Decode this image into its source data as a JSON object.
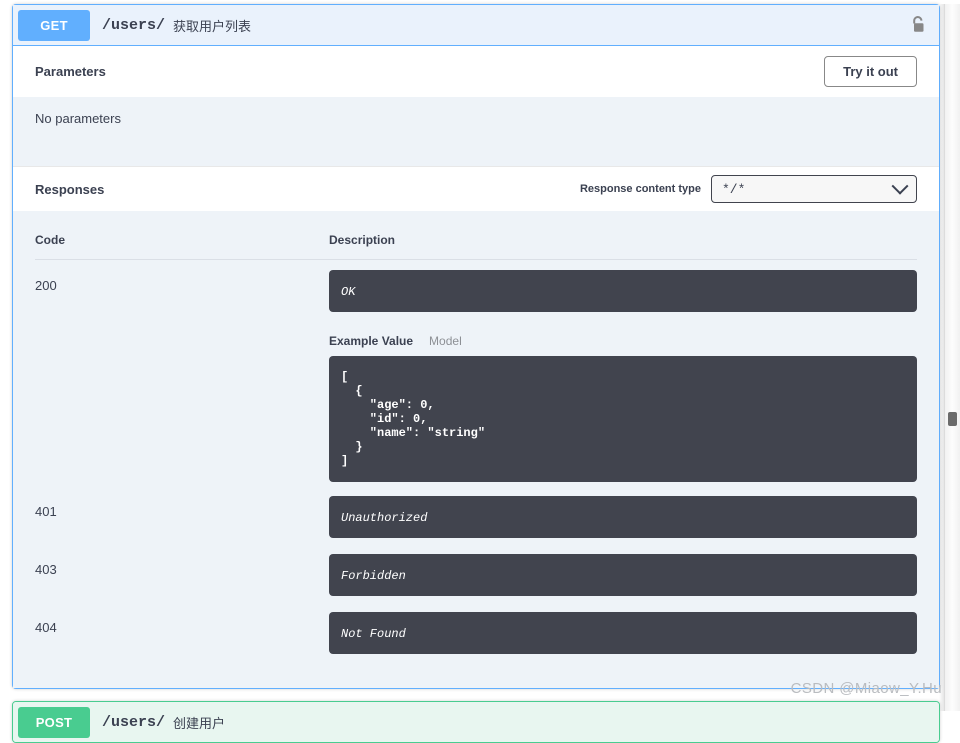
{
  "operation_get": {
    "method": "GET",
    "path": "/users/",
    "summary": "获取用户列表",
    "auth_icon": "unlock-icon",
    "parameters": {
      "title": "Parameters",
      "try_it_out_label": "Try it out",
      "empty_text": "No parameters"
    },
    "responses": {
      "title": "Responses",
      "content_type_label": "Response content type",
      "content_type_value": "*/*",
      "chevron_icon": "chevron-down-icon",
      "columns": {
        "code": "Code",
        "description": "Description"
      },
      "rows": [
        {
          "code": "200",
          "description": "OK",
          "example": {
            "tab_active": "Example Value",
            "tab_inactive": "Model",
            "body": "[\n  {\n    \"age\": 0,\n    \"id\": 0,\n    \"name\": \"string\"\n  }\n]"
          }
        },
        {
          "code": "401",
          "description": "Unauthorized"
        },
        {
          "code": "403",
          "description": "Forbidden"
        },
        {
          "code": "404",
          "description": "Not Found"
        }
      ]
    }
  },
  "operation_post": {
    "method": "POST",
    "path": "/users/",
    "summary": "创建用户"
  },
  "watermark": "CSDN @Miaow_Y.Hu",
  "colors": {
    "get_accent": "#61affe",
    "post_accent": "#49cc90",
    "block_bg": "#eef3f8",
    "code_bg": "#41444e",
    "text": "#3b4151"
  }
}
